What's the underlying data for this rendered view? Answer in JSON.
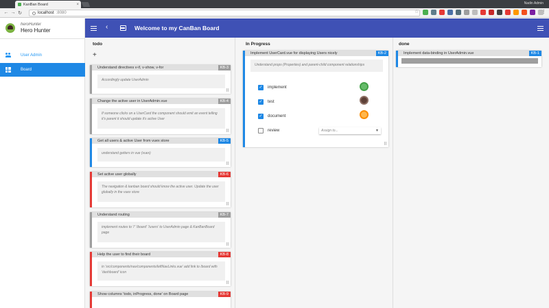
{
  "browser": {
    "tab_title": "KanBan Board",
    "tab_close": "×",
    "profile": "Nadin Admin",
    "url_host": "localhost",
    "url_port": ":8080",
    "back": "←",
    "forward": "→",
    "reload": "↻",
    "star": "☆",
    "menu": "⋮",
    "extension_colors": [
      "#4caf50",
      "#607d8b",
      "#e53935",
      "#4a6fa5",
      "#546e7a",
      "#9e9e9e",
      "#bdbdbd",
      "#e53935",
      "#c62828",
      "#424242",
      "#e53935",
      "#ff9800",
      "#f4511e",
      "#7b1fa2",
      "#bdbdbd"
    ]
  },
  "drawer": {
    "user_handle": "heroHunter",
    "user_name": "Hero Hunter",
    "items": [
      {
        "label": "User Admin",
        "icon": "people-icon",
        "active": false
      },
      {
        "label": "Board",
        "icon": "dashboard-icon",
        "active": true
      }
    ]
  },
  "appbar": {
    "title": "Welcome to my CanBan Board",
    "back_icon": "‹"
  },
  "colors": {
    "appbar": "#3f51b5",
    "accent": "#1e88e5",
    "red": "#e53935",
    "gray": "#9e9e9e"
  },
  "board": {
    "add_label": "+",
    "columns": [
      {
        "title": "todo",
        "cards": [
          {
            "title": "Understand directives v-if, v-show, v-for",
            "id": "KB-3",
            "color": "gray",
            "body": "Accordingly update UserAdmin"
          },
          {
            "title": "Change the active user in UserAdmin.vue",
            "id": "KB-4",
            "color": "gray",
            "body": "If someone clicks on a UserCard the component should emit an event telling it's parent it should update it's active User"
          },
          {
            "title": "Get all users & active User from vuex store",
            "id": "KB-5",
            "color": "blue",
            "body": "understand getters in vue (vuex)"
          },
          {
            "title": "Set active user globally",
            "id": "KB-6",
            "color": "red",
            "body": "The navigation & kanban board should know the active user. Update the user globally in the vuex store"
          },
          {
            "title": "Understand routing",
            "id": "KB-7",
            "color": "gray",
            "body": "implement routes to '/' '/board' '/users' to UserAdmin page & KanBanBoard page"
          },
          {
            "title": "Help the user to find their board",
            "id": "KB-8",
            "color": "red",
            "body": "in 'src/components/nav/components/leftNavLinks.vue' add link to /board with 'dashboard' icon"
          },
          {
            "title": "Show columns 'todo, inProgress, done' on Board page",
            "id": "KB-9",
            "color": "red",
            "body": ""
          }
        ]
      },
      {
        "title": "In Progress",
        "cards": [
          {
            "title": "Implement UserCard.vue for displaying Users nicely",
            "id": "KB-2",
            "color": "blue",
            "body": "Understand props (Properties) and parent-child component relationships",
            "tasks": [
              {
                "label": "implement",
                "checked": true,
                "check_mark": "✓"
              },
              {
                "label": "test",
                "checked": true,
                "check_mark": "✓"
              },
              {
                "label": "document",
                "checked": true,
                "check_mark": "✓"
              },
              {
                "label": "review",
                "checked": false,
                "check_mark": ""
              }
            ],
            "assign_placeholder": "Assign to...",
            "assign_caret": "▼"
          }
        ]
      },
      {
        "title": "done",
        "cards": [
          {
            "title": "Implement data-binding in UserAdmin.vue",
            "id": "KB-1",
            "color": "blue",
            "body": ""
          }
        ]
      }
    ]
  }
}
